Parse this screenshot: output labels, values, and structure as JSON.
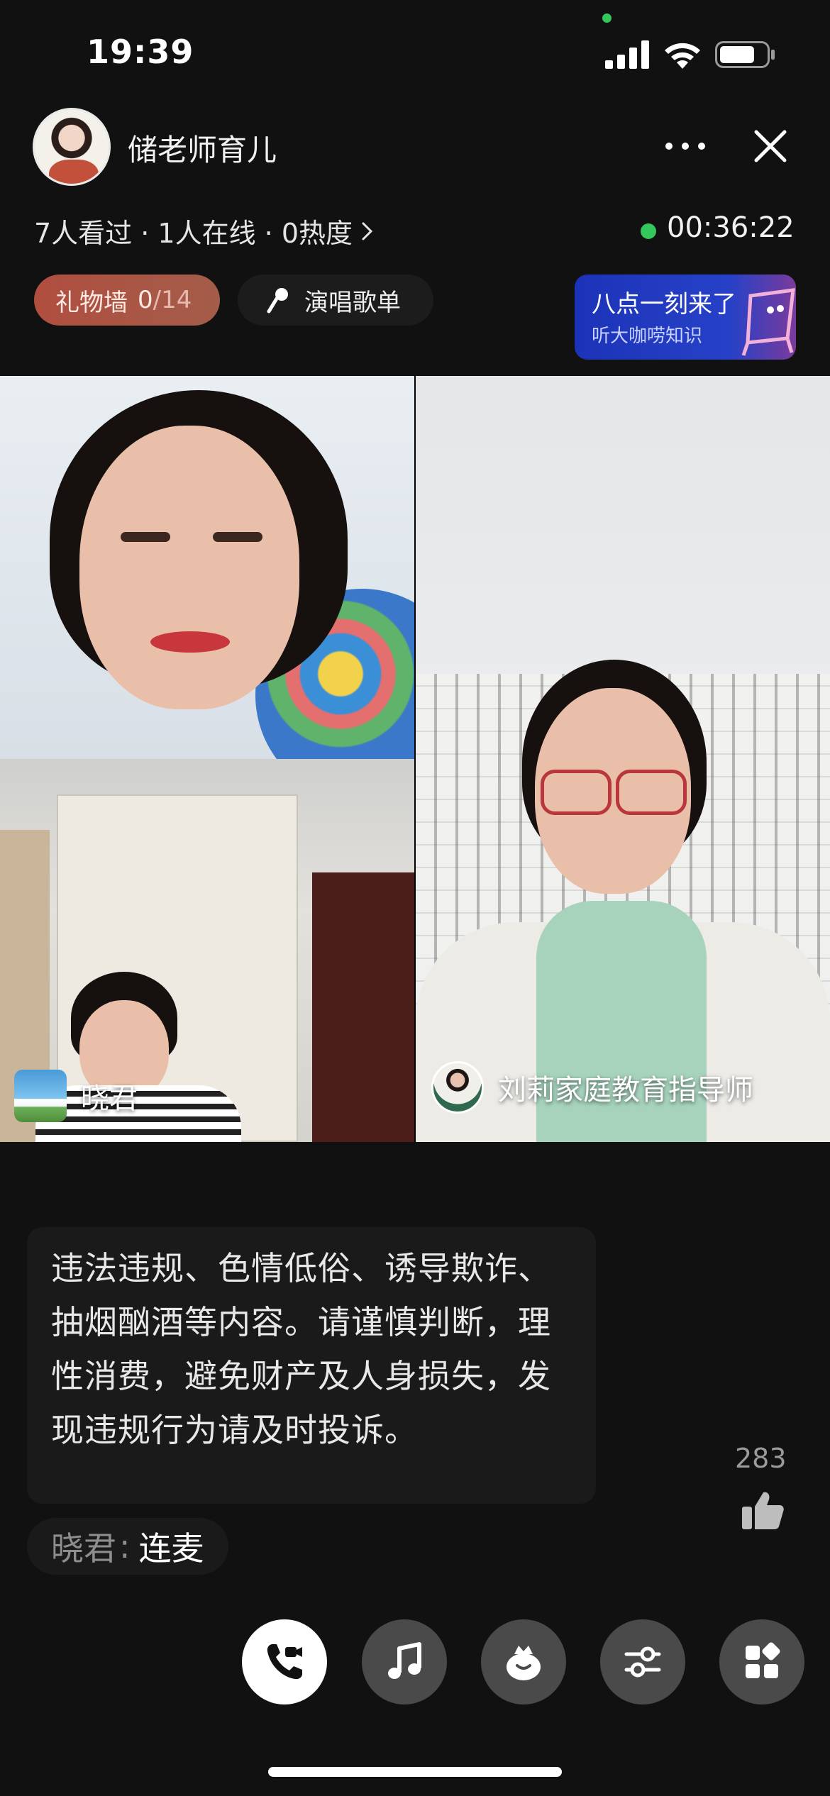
{
  "status_bar": {
    "time": "19:39"
  },
  "header": {
    "host_name": "储老师育儿",
    "stats": "7人看过 · 1人在线 · 0热度",
    "live_timer": "00:36:22"
  },
  "gift_wall": {
    "label": "礼物墙",
    "count": "0",
    "total": "/14"
  },
  "song_list": {
    "label": "演唱歌单"
  },
  "promo": {
    "title": "八点一刻来了",
    "subtitle": "听大咖唠知识"
  },
  "video_tiles": [
    {
      "name": ""
    },
    {
      "name": "晓君"
    },
    {
      "name": "刘莉家庭教育指导师"
    }
  ],
  "chat": {
    "notice": "违法违规、色情低俗、诱导欺诈、抽烟酗酒等内容。请谨慎判断，理性消费，避免财产及人身损失，发现违规行为请及时投诉。",
    "messages": [
      {
        "user": "晓君",
        "separator": ":",
        "text": "连麦"
      }
    ]
  },
  "likes": {
    "count": "283"
  },
  "toolbar": {
    "buttons": [
      {
        "icon": "phone-video-icon"
      },
      {
        "icon": "music-note-icon"
      },
      {
        "icon": "gift-bag-icon"
      },
      {
        "icon": "sliders-icon"
      },
      {
        "icon": "grid-apps-icon"
      }
    ]
  },
  "colors": {
    "background": "#111111",
    "live_green": "#34c759",
    "gift_wall": "#b04e40",
    "promo_blue": "#2641c8"
  }
}
